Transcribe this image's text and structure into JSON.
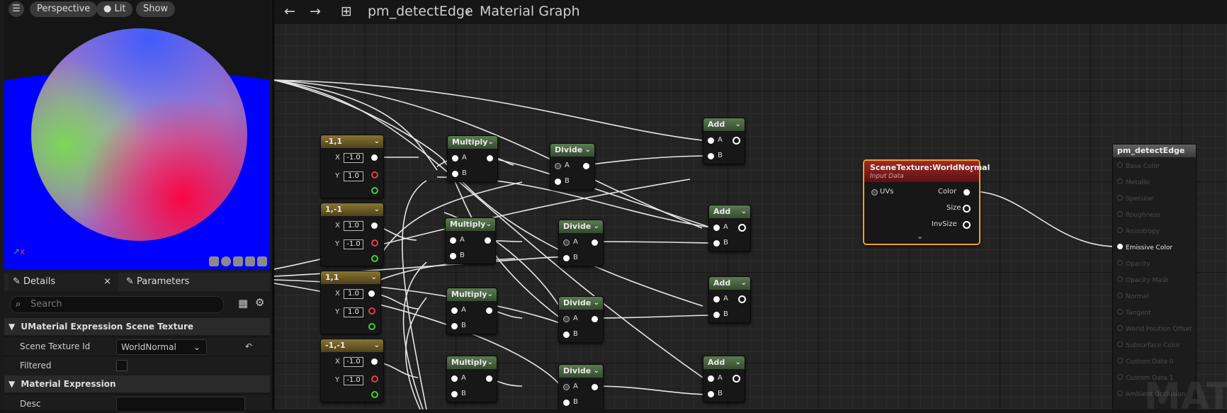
{
  "viewport": {
    "perspective_label": "Perspective",
    "lit_label": "Lit",
    "show_label": "Show",
    "axis_label": "x"
  },
  "details_panel": {
    "details_tab": "Details",
    "parameters_tab": "Parameters",
    "search_placeholder": "Search",
    "section1": "UMaterial Expression Scene Texture",
    "scene_texture_id_label": "Scene Texture Id",
    "scene_texture_id_value": "WorldNormal",
    "filtered_label": "Filtered",
    "section2": "Material Expression",
    "desc_label": "Desc"
  },
  "header": {
    "asset": "pm_detectEdge",
    "graph": "Material Graph"
  },
  "constant_nodes": [
    {
      "title": "-1,1",
      "x_value": "-1.0",
      "y_value": "1.0"
    },
    {
      "title": "1,-1",
      "x_value": "1.0",
      "y_value": "-1.0"
    },
    {
      "title": "1,1",
      "x_value": "1.0",
      "y_value": "1.0"
    },
    {
      "title": "-1,-1",
      "x_value": "-1.0",
      "y_value": "-1.0"
    }
  ],
  "pins": {
    "x": "X",
    "y": "Y",
    "a": "A",
    "b": "B"
  },
  "multiply_title": "Multiply",
  "divide_title": "Divide",
  "add_title": "Add",
  "scene_texture_node": {
    "title": "SceneTexture:WorldNormal",
    "subtitle": "Input Data",
    "uvs": "UVs",
    "color": "Color",
    "size": "Size",
    "invsize": "InvSize"
  },
  "result_node": {
    "title": "pm_detectEdge",
    "pins": [
      "Base Color",
      "Metallic",
      "Specular",
      "Roughness",
      "Anisotropy",
      "Emissive Color",
      "Opacity",
      "Opacity Mask",
      "Normal",
      "Tangent",
      "World Position Offset",
      "Subsurface Color",
      "Custom Data 0",
      "Custom Data 1",
      "Ambient Occlusion"
    ],
    "active_pin": "Emissive Color"
  },
  "watermark": "MATE"
}
